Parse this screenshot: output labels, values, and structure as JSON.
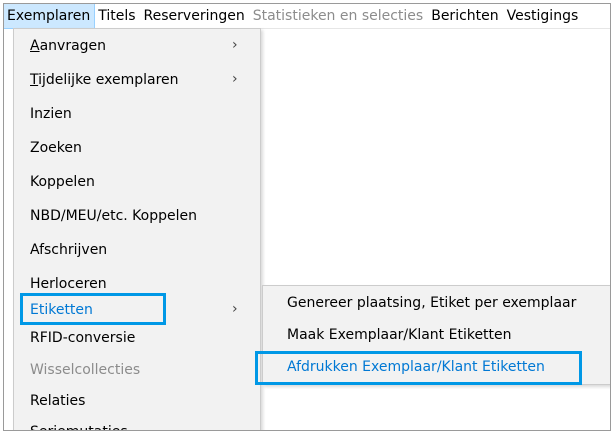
{
  "menubar": {
    "items": [
      {
        "label": "Exemplaren",
        "state": "active"
      },
      {
        "label": "Titels",
        "state": "normal"
      },
      {
        "label": "Reserveringen",
        "state": "normal"
      },
      {
        "label": "Statistieken en selecties",
        "state": "disabled"
      },
      {
        "label": "Berichten",
        "state": "normal"
      },
      {
        "label": "Vestigings",
        "state": "normal"
      }
    ]
  },
  "dropdown": {
    "items": [
      {
        "label": "Aanvragen",
        "has_submenu": true,
        "state": "normal"
      },
      {
        "label": "Tijdelijke exemplaren",
        "has_submenu": true,
        "state": "normal"
      },
      {
        "label": "Inzien",
        "has_submenu": false,
        "state": "normal"
      },
      {
        "label": "Zoeken",
        "has_submenu": false,
        "state": "normal"
      },
      {
        "label": "Koppelen",
        "has_submenu": false,
        "state": "normal"
      },
      {
        "label": "NBD/MEU/etc. Koppelen",
        "has_submenu": false,
        "state": "normal"
      },
      {
        "label": "Afschrijven",
        "has_submenu": false,
        "state": "normal"
      },
      {
        "label": "Herloceren",
        "has_submenu": false,
        "state": "normal"
      },
      {
        "label": "Etiketten",
        "has_submenu": true,
        "state": "highlighted"
      },
      {
        "label": "RFID-conversie",
        "has_submenu": false,
        "state": "normal"
      },
      {
        "label": "Wisselcollecties",
        "has_submenu": false,
        "state": "disabled"
      },
      {
        "label": "Relaties",
        "has_submenu": false,
        "state": "normal"
      },
      {
        "label": "Seriemutaties",
        "has_submenu": false,
        "state": "normal"
      }
    ],
    "chevron_glyph": "›"
  },
  "submenu": {
    "items": [
      {
        "label": "Genereer plaatsing, Etiket per exemplaar",
        "state": "normal"
      },
      {
        "label": "Maak Exemplaar/Klant Etiketten",
        "state": "normal"
      },
      {
        "label": "Afdrukken Exemplaar/Klant Etiketten",
        "state": "highlighted"
      }
    ]
  },
  "colors": {
    "highlight_border": "#0098e6",
    "highlight_text": "#0078d4",
    "menu_background": "#f2f2f2",
    "disabled_text": "#8c8c8c",
    "menubar_active_bg": "#cce8ff"
  }
}
